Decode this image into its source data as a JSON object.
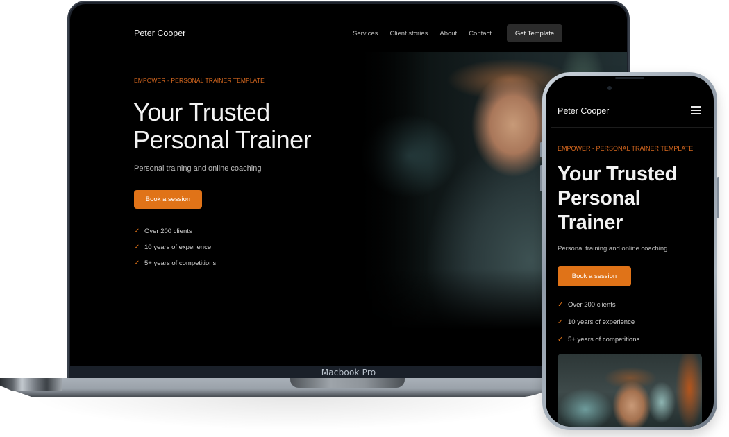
{
  "device_labels": {
    "laptop": "Macbook Pro"
  },
  "site": {
    "brand": "Peter Cooper",
    "nav_links": [
      "Services",
      "Client stories",
      "About",
      "Contact"
    ],
    "cta_label": "Get Template",
    "eyebrow": "EMPOWER - PERSONAL TRAINER TEMPLATE",
    "title_line1": "Your Trusted",
    "title_line2": "Personal Trainer",
    "mobile_title_lines": [
      "Your Trusted",
      "Personal",
      "Trainer"
    ],
    "subtitle": "Personal training and online coaching",
    "book_label": "Book a session",
    "highlights": [
      "Over 200 clients",
      "10 years of experience",
      "5+ years of competitions"
    ],
    "hero_image_alt": "Smiling personal trainer in a gym",
    "check_icon": "✓",
    "colors": {
      "accent": "#e07318",
      "background": "#000000",
      "text": "#f2f2f2",
      "cta_bg": "#2b2b2b"
    }
  }
}
